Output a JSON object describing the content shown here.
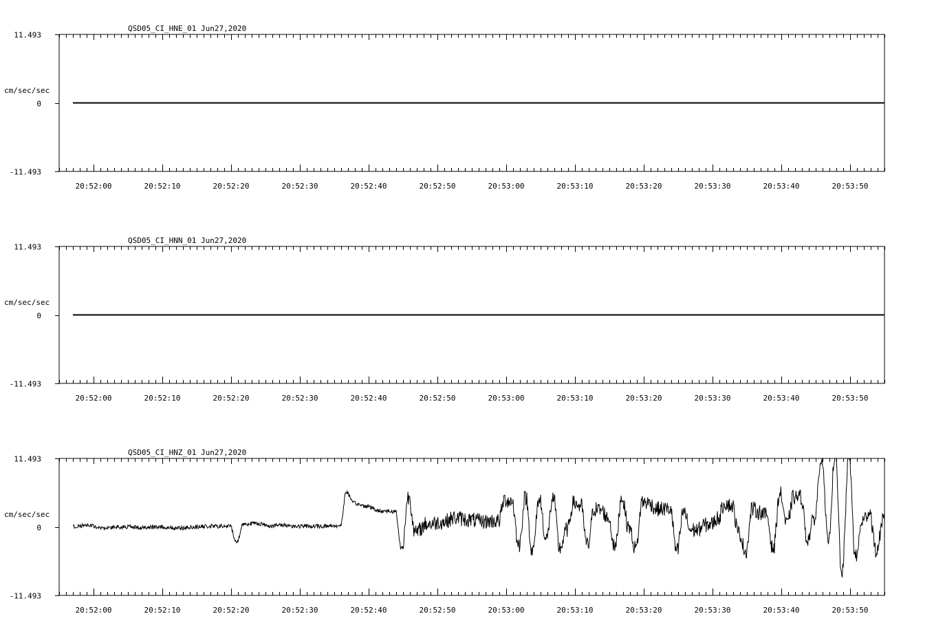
{
  "chart_data": [
    {
      "type": "line",
      "title": "QSD05_CI_HNE_01  Jun27,2020",
      "ylabel": "cm/sec/sec",
      "y_ticks": [
        "11.493",
        "0",
        "-11.493"
      ],
      "ylim": [
        -11.493,
        11.493
      ],
      "x_ticks": [
        "20:52:00",
        "20:52:10",
        "20:52:20",
        "20:52:30",
        "20:52:40",
        "20:52:50",
        "20:53:00",
        "20:53:10",
        "20:53:20",
        "20:53:30",
        "20:53:40",
        "20:53:50"
      ],
      "xlim": [
        "20:51:55",
        "20:53:55"
      ],
      "series": [
        {
          "x": [
            "20:51:57",
            "20:53:55"
          ],
          "values": [
            0,
            0
          ]
        }
      ]
    },
    {
      "type": "line",
      "title": "QSD05_CI_HNN_01  Jun27,2020",
      "ylabel": "cm/sec/sec",
      "y_ticks": [
        "11.493",
        "0",
        "-11.493"
      ],
      "ylim": [
        -11.493,
        11.493
      ],
      "x_ticks": [
        "20:52:00",
        "20:52:10",
        "20:52:20",
        "20:52:30",
        "20:52:40",
        "20:52:50",
        "20:53:00",
        "20:53:10",
        "20:53:20",
        "20:53:30",
        "20:53:40",
        "20:53:50"
      ],
      "xlim": [
        "20:51:55",
        "20:53:55"
      ],
      "series": [
        {
          "x": [
            "20:51:57",
            "20:53:55"
          ],
          "values": [
            0,
            0
          ]
        }
      ]
    },
    {
      "type": "line",
      "title": "QSD05_CI_HNZ_01  Jun27,2020",
      "ylabel": "cm/sec/sec",
      "y_ticks": [
        "11.493",
        "0",
        "-11.493"
      ],
      "ylim": [
        -11.493,
        11.493
      ],
      "x_ticks": [
        "20:52:00",
        "20:52:10",
        "20:52:20",
        "20:52:30",
        "20:52:40",
        "20:52:50",
        "20:53:00",
        "20:53:10",
        "20:53:20",
        "20:53:30",
        "20:53:40",
        "20:53:50"
      ],
      "xlim": [
        "20:51:55",
        "20:53:55"
      ],
      "series": [
        {
          "x": [
            "20:51:57",
            "20:52:00",
            "20:52:02",
            "20:52:05",
            "20:52:08",
            "20:52:10",
            "20:52:13",
            "20:52:15",
            "20:52:18",
            "20:52:20",
            "20:52:21",
            "20:52:22",
            "20:52:24",
            "20:52:26",
            "20:52:28",
            "20:52:30",
            "20:52:33",
            "20:52:36",
            "20:52:37",
            "20:52:38",
            "20:52:40",
            "20:52:42",
            "20:52:44",
            "20:52:45",
            "20:52:46",
            "20:52:47",
            "20:52:49",
            "20:52:51",
            "20:52:53",
            "20:52:55",
            "20:52:57",
            "20:52:59",
            "20:53:00",
            "20:53:01",
            "20:53:02",
            "20:53:03",
            "20:53:04",
            "20:53:05",
            "20:53:06",
            "20:53:07",
            "20:53:08",
            "20:53:09",
            "20:53:10",
            "20:53:11",
            "20:53:12",
            "20:53:13",
            "20:53:14",
            "20:53:15",
            "20:53:16",
            "20:53:17",
            "20:53:18",
            "20:53:19",
            "20:53:20",
            "20:53:21",
            "20:53:22",
            "20:53:23",
            "20:53:24",
            "20:53:25",
            "20:53:26",
            "20:53:27",
            "20:53:28",
            "20:53:29",
            "20:53:30",
            "20:53:31",
            "20:53:32",
            "20:53:33",
            "20:53:34",
            "20:53:35",
            "20:53:36",
            "20:53:37",
            "20:53:38",
            "20:53:39",
            "20:53:40",
            "20:53:41",
            "20:53:42",
            "20:53:43",
            "20:53:44",
            "20:53:45",
            "20:53:46",
            "20:53:47",
            "20:53:48",
            "20:53:49",
            "20:53:50",
            "20:53:51",
            "20:53:52",
            "20:53:53",
            "20:53:54",
            "20:53:55"
          ],
          "values": [
            0.1,
            0.2,
            -0.2,
            0.0,
            -0.1,
            0.0,
            -0.2,
            0.0,
            0.1,
            0.1,
            -2.5,
            0.5,
            0.6,
            0.2,
            0.3,
            0.1,
            0.1,
            0.2,
            5.8,
            4.0,
            3.5,
            2.7,
            2.6,
            -3.5,
            5.0,
            -1.0,
            0.5,
            0.8,
            1.5,
            1.2,
            0.9,
            1.0,
            4.5,
            4.3,
            -3.0,
            4.8,
            -4.0,
            4.5,
            -2.0,
            4.7,
            -3.5,
            -0.5,
            4.0,
            3.5,
            -3.0,
            3.0,
            2.8,
            1.5,
            -3.3,
            4.8,
            0.0,
            -3.5,
            4.2,
            4.0,
            3.0,
            3.0,
            3.0,
            -4.0,
            2.5,
            -0.5,
            -0.5,
            0.3,
            0.5,
            1.5,
            4.0,
            3.5,
            -1.0,
            -4.0,
            3.0,
            2.5,
            2.0,
            -3.5,
            5.5,
            0.5,
            5.0,
            5.0,
            -2.0,
            1.5,
            11.493,
            -2.0,
            11.493,
            -7.5,
            11.493,
            -5.0,
            1.0,
            2.5,
            -4.0,
            1.0
          ]
        }
      ]
    }
  ]
}
